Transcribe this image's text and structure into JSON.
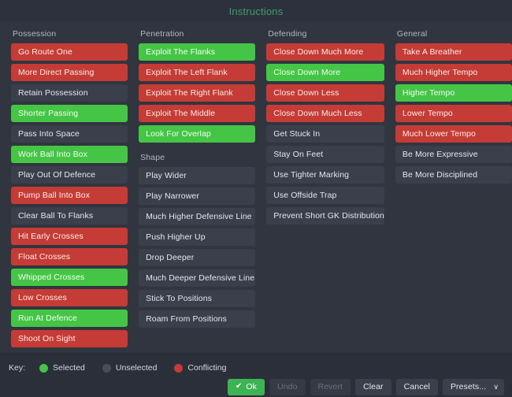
{
  "header": {
    "title": "Instructions",
    "title_color": "#3f9c6a"
  },
  "colors": {
    "selected": "#45c545",
    "unselected": "#3a3f4b",
    "conflicting": "#c43c35",
    "panel_bg": "#31353f",
    "page_bg": "#2b2f3a"
  },
  "columns": [
    {
      "heading": "Possession",
      "items": [
        {
          "label": "Go Route One",
          "state": "conflicting"
        },
        {
          "label": "More Direct Passing",
          "state": "conflicting"
        },
        {
          "label": "Retain Possession",
          "state": "unselected"
        },
        {
          "label": "Shorter Passing",
          "state": "selected"
        },
        {
          "label": "Pass Into Space",
          "state": "unselected"
        },
        {
          "label": "Work Ball Into Box",
          "state": "selected"
        },
        {
          "label": "Play Out Of Defence",
          "state": "unselected"
        },
        {
          "label": "Pump Ball Into Box",
          "state": "conflicting"
        },
        {
          "label": "Clear Ball To Flanks",
          "state": "unselected"
        },
        {
          "label": "Hit Early Crosses",
          "state": "conflicting"
        },
        {
          "label": "Float Crosses",
          "state": "conflicting"
        },
        {
          "label": "Whipped Crosses",
          "state": "selected"
        },
        {
          "label": "Low Crosses",
          "state": "conflicting"
        },
        {
          "label": "Run At Defence",
          "state": "selected"
        },
        {
          "label": "Shoot On Sight",
          "state": "conflicting"
        }
      ]
    },
    {
      "heading": "Penetration",
      "items": [
        {
          "label": "Exploit The Flanks",
          "state": "selected"
        },
        {
          "label": "Exploit The Left Flank",
          "state": "conflicting"
        },
        {
          "label": "Exploit The Right Flank",
          "state": "conflicting"
        },
        {
          "label": "Exploit The Middle",
          "state": "conflicting"
        },
        {
          "label": "Look For Overlap",
          "state": "selected"
        }
      ],
      "subheading": "Shape",
      "subitems": [
        {
          "label": "Play Wider",
          "state": "unselected"
        },
        {
          "label": "Play Narrower",
          "state": "unselected"
        },
        {
          "label": "Much Higher Defensive Line",
          "state": "unselected"
        },
        {
          "label": "Push Higher Up",
          "state": "unselected"
        },
        {
          "label": "Drop Deeper",
          "state": "unselected"
        },
        {
          "label": "Much Deeper Defensive Line",
          "state": "unselected"
        },
        {
          "label": "Stick To Positions",
          "state": "unselected"
        },
        {
          "label": "Roam From Positions",
          "state": "unselected"
        }
      ]
    },
    {
      "heading": "Defending",
      "items": [
        {
          "label": "Close Down Much More",
          "state": "conflicting"
        },
        {
          "label": "Close Down More",
          "state": "selected"
        },
        {
          "label": "Close Down Less",
          "state": "conflicting"
        },
        {
          "label": "Close Down Much Less",
          "state": "conflicting"
        },
        {
          "label": "Get Stuck In",
          "state": "unselected"
        },
        {
          "label": "Stay On Feet",
          "state": "unselected"
        },
        {
          "label": "Use Tighter Marking",
          "state": "unselected"
        },
        {
          "label": "Use Offside Trap",
          "state": "unselected"
        },
        {
          "label": "Prevent Short GK Distribution",
          "state": "unselected"
        }
      ]
    },
    {
      "heading": "General",
      "items": [
        {
          "label": "Take A Breather",
          "state": "conflicting"
        },
        {
          "label": "Much Higher Tempo",
          "state": "conflicting"
        },
        {
          "label": "Higher Tempo",
          "state": "selected"
        },
        {
          "label": "Lower Tempo",
          "state": "conflicting"
        },
        {
          "label": "Much Lower Tempo",
          "state": "conflicting"
        },
        {
          "label": "Be More Expressive",
          "state": "unselected"
        },
        {
          "label": "Be More Disciplined",
          "state": "unselected"
        }
      ]
    }
  ],
  "legend": {
    "label": "Key:",
    "entries": [
      {
        "label": "Selected",
        "color": "#45c545",
        "swatch": "green"
      },
      {
        "label": "Unselected",
        "color": "#474d5a",
        "swatch": "grey"
      },
      {
        "label": "Conflicting",
        "color": "#c43c35",
        "swatch": "red"
      }
    ]
  },
  "footer": {
    "buttons": [
      {
        "label": "Ok",
        "style": "primary",
        "icon": "check-icon",
        "name": "ok-button"
      },
      {
        "label": "Undo",
        "style": "disabled",
        "name": "undo-button"
      },
      {
        "label": "Revert",
        "style": "disabled",
        "name": "revert-button"
      },
      {
        "label": "Clear",
        "style": "normal",
        "name": "clear-button"
      },
      {
        "label": "Cancel",
        "style": "normal",
        "name": "cancel-button"
      },
      {
        "label": "Presets...",
        "style": "dropdown",
        "icon": "chevron-down-icon",
        "name": "presets-dropdown"
      }
    ],
    "check_glyph": "✔",
    "caret_glyph": "∨"
  }
}
